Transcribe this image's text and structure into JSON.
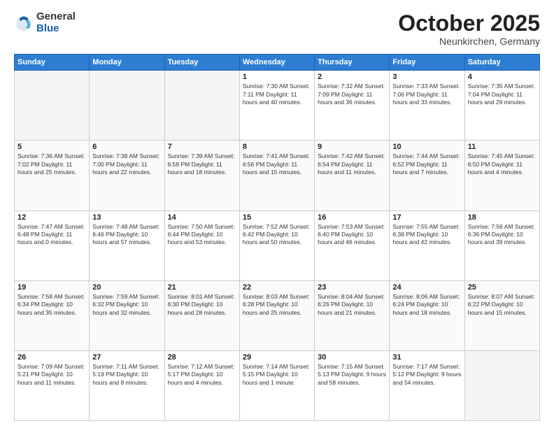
{
  "header": {
    "logo_general": "General",
    "logo_blue": "Blue",
    "month_title": "October 2025",
    "location": "Neunkirchen, Germany"
  },
  "weekdays": [
    "Sunday",
    "Monday",
    "Tuesday",
    "Wednesday",
    "Thursday",
    "Friday",
    "Saturday"
  ],
  "weeks": [
    [
      {
        "day": "",
        "info": ""
      },
      {
        "day": "",
        "info": ""
      },
      {
        "day": "",
        "info": ""
      },
      {
        "day": "1",
        "info": "Sunrise: 7:30 AM\nSunset: 7:11 PM\nDaylight: 11 hours\nand 40 minutes."
      },
      {
        "day": "2",
        "info": "Sunrise: 7:32 AM\nSunset: 7:09 PM\nDaylight: 11 hours\nand 36 minutes."
      },
      {
        "day": "3",
        "info": "Sunrise: 7:33 AM\nSunset: 7:06 PM\nDaylight: 11 hours\nand 33 minutes."
      },
      {
        "day": "4",
        "info": "Sunrise: 7:35 AM\nSunset: 7:04 PM\nDaylight: 11 hours\nand 29 minutes."
      }
    ],
    [
      {
        "day": "5",
        "info": "Sunrise: 7:36 AM\nSunset: 7:02 PM\nDaylight: 11 hours\nand 25 minutes."
      },
      {
        "day": "6",
        "info": "Sunrise: 7:38 AM\nSunset: 7:00 PM\nDaylight: 11 hours\nand 22 minutes."
      },
      {
        "day": "7",
        "info": "Sunrise: 7:39 AM\nSunset: 6:58 PM\nDaylight: 11 hours\nand 18 minutes."
      },
      {
        "day": "8",
        "info": "Sunrise: 7:41 AM\nSunset: 6:56 PM\nDaylight: 11 hours\nand 15 minutes."
      },
      {
        "day": "9",
        "info": "Sunrise: 7:42 AM\nSunset: 6:54 PM\nDaylight: 11 hours\nand 11 minutes."
      },
      {
        "day": "10",
        "info": "Sunrise: 7:44 AM\nSunset: 6:52 PM\nDaylight: 11 hours\nand 7 minutes."
      },
      {
        "day": "11",
        "info": "Sunrise: 7:45 AM\nSunset: 6:50 PM\nDaylight: 11 hours\nand 4 minutes."
      }
    ],
    [
      {
        "day": "12",
        "info": "Sunrise: 7:47 AM\nSunset: 6:48 PM\nDaylight: 11 hours\nand 0 minutes."
      },
      {
        "day": "13",
        "info": "Sunrise: 7:48 AM\nSunset: 6:46 PM\nDaylight: 10 hours\nand 57 minutes."
      },
      {
        "day": "14",
        "info": "Sunrise: 7:50 AM\nSunset: 6:44 PM\nDaylight: 10 hours\nand 53 minutes."
      },
      {
        "day": "15",
        "info": "Sunrise: 7:52 AM\nSunset: 6:42 PM\nDaylight: 10 hours\nand 50 minutes."
      },
      {
        "day": "16",
        "info": "Sunrise: 7:53 AM\nSunset: 6:40 PM\nDaylight: 10 hours\nand 46 minutes."
      },
      {
        "day": "17",
        "info": "Sunrise: 7:55 AM\nSunset: 6:38 PM\nDaylight: 10 hours\nand 42 minutes."
      },
      {
        "day": "18",
        "info": "Sunrise: 7:56 AM\nSunset: 6:36 PM\nDaylight: 10 hours\nand 39 minutes."
      }
    ],
    [
      {
        "day": "19",
        "info": "Sunrise: 7:58 AM\nSunset: 6:34 PM\nDaylight: 10 hours\nand 35 minutes."
      },
      {
        "day": "20",
        "info": "Sunrise: 7:59 AM\nSunset: 6:32 PM\nDaylight: 10 hours\nand 32 minutes."
      },
      {
        "day": "21",
        "info": "Sunrise: 8:01 AM\nSunset: 6:30 PM\nDaylight: 10 hours\nand 28 minutes."
      },
      {
        "day": "22",
        "info": "Sunrise: 8:03 AM\nSunset: 6:28 PM\nDaylight: 10 hours\nand 25 minutes."
      },
      {
        "day": "23",
        "info": "Sunrise: 8:04 AM\nSunset: 6:26 PM\nDaylight: 10 hours\nand 21 minutes."
      },
      {
        "day": "24",
        "info": "Sunrise: 8:06 AM\nSunset: 6:24 PM\nDaylight: 10 hours\nand 18 minutes."
      },
      {
        "day": "25",
        "info": "Sunrise: 8:07 AM\nSunset: 6:22 PM\nDaylight: 10 hours\nand 15 minutes."
      }
    ],
    [
      {
        "day": "26",
        "info": "Sunrise: 7:09 AM\nSunset: 5:21 PM\nDaylight: 10 hours\nand 11 minutes."
      },
      {
        "day": "27",
        "info": "Sunrise: 7:11 AM\nSunset: 5:19 PM\nDaylight: 10 hours\nand 8 minutes."
      },
      {
        "day": "28",
        "info": "Sunrise: 7:12 AM\nSunset: 5:17 PM\nDaylight: 10 hours\nand 4 minutes."
      },
      {
        "day": "29",
        "info": "Sunrise: 7:14 AM\nSunset: 5:15 PM\nDaylight: 10 hours\nand 1 minute."
      },
      {
        "day": "30",
        "info": "Sunrise: 7:15 AM\nSunset: 5:13 PM\nDaylight: 9 hours\nand 58 minutes."
      },
      {
        "day": "31",
        "info": "Sunrise: 7:17 AM\nSunset: 5:12 PM\nDaylight: 9 hours\nand 54 minutes."
      },
      {
        "day": "",
        "info": ""
      }
    ]
  ]
}
